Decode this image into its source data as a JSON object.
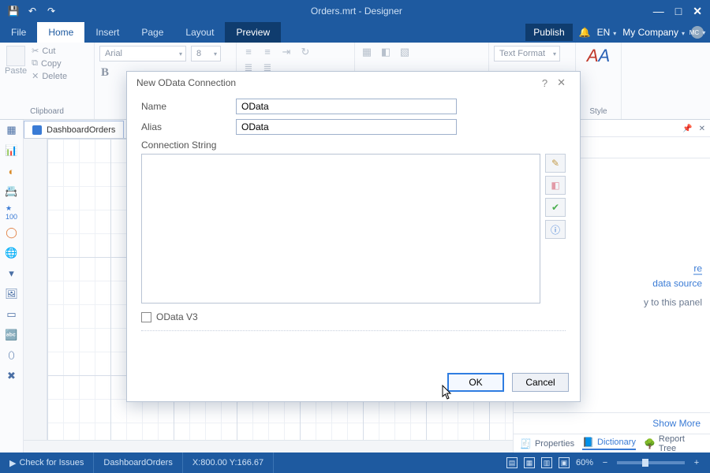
{
  "titlebar": {
    "title": "Orders.mrt - Designer"
  },
  "menu": {
    "file": "File",
    "home": "Home",
    "insert": "Insert",
    "page": "Page",
    "layout": "Layout",
    "preview": "Preview",
    "publish": "Publish",
    "lang": "EN",
    "company": "My Company"
  },
  "ribbon": {
    "paste": "Paste",
    "cut": "Cut",
    "copy": "Copy",
    "delete": "Delete",
    "clipboard_group": "Clipboard",
    "font_name": "Arial",
    "font_size": "8",
    "text_format": "Text Format",
    "style": "Style"
  },
  "doc": {
    "tab_label": "DashboardOrders"
  },
  "right": {
    "link1": "re",
    "link2": "data source",
    "drag_hint": "y to this panel",
    "show_more": "Show More",
    "tab_properties": "Properties",
    "tab_dictionary": "Dictionary",
    "tab_report_tree": "Report Tree"
  },
  "dialog": {
    "title": "New OData Connection",
    "name_label": "Name",
    "name_value": "OData",
    "alias_label": "Alias",
    "alias_value": "OData",
    "cs_label": "Connection String",
    "v3_label": "OData V3",
    "ok": "OK",
    "cancel": "Cancel"
  },
  "status": {
    "check": "Check for Issues",
    "doc": "DashboardOrders",
    "coords": "X:800.00 Y:166.67",
    "zoom": "60%"
  }
}
